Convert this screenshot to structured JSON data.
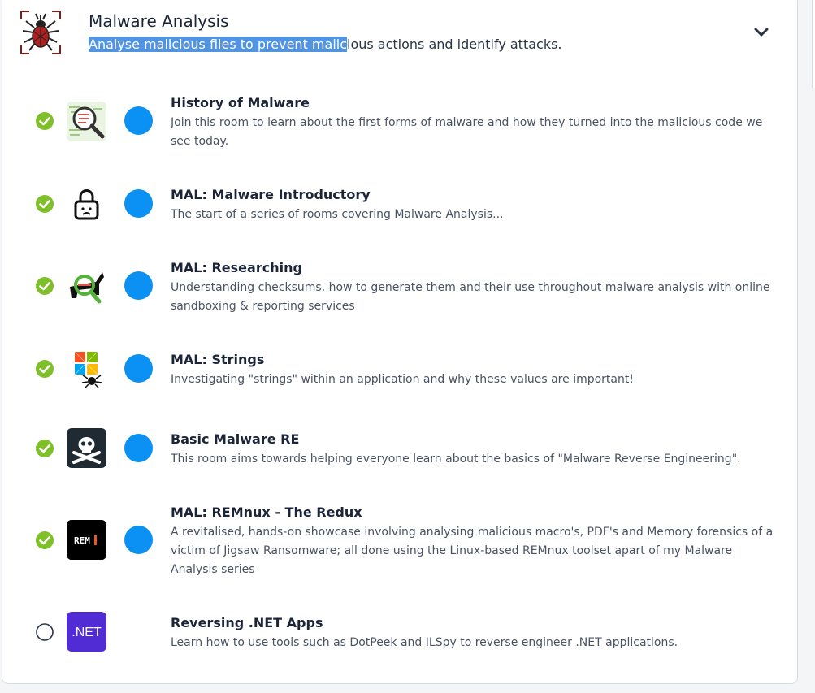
{
  "module": {
    "title": "Malware Analysis",
    "description_selected": "Analyse malicious files to prevent malic",
    "description_rest": "ious actions and identify attacks.",
    "logo_icon": "spider-bug-icon",
    "expand_icon": "chevron-down-icon"
  },
  "colors": {
    "complete_green": "#7fbf2a",
    "room_dot_blue": "#0b91f3",
    "selection_blue": "#5294e2",
    "dotnet_purple": "#512bd4"
  },
  "rooms": [
    {
      "title": "History of Malware",
      "description": "Join this room to learn about the first forms of malware and how they turned into the malicious code we see today.",
      "completed": true,
      "icon": "magnifier-code-icon"
    },
    {
      "title": "MAL: Malware Introductory",
      "description": "The start of a series of rooms covering Malware Analysis...",
      "completed": true,
      "icon": "padlock-icon"
    },
    {
      "title": "MAL: Researching",
      "description": "Understanding checksums, how to generate them and their use throughout malware analysis with online sandboxing & reporting services",
      "completed": true,
      "icon": "research-horse-icon"
    },
    {
      "title": "MAL: Strings",
      "description": "Investigating \"strings\" within an application and why these values are important!",
      "completed": true,
      "icon": "windows-spider-icon"
    },
    {
      "title": "Basic Malware RE",
      "description": "This room aims towards helping everyone learn about the basics of \"Malware Reverse Engineering\".",
      "completed": true,
      "icon": "skull-crossbones-icon"
    },
    {
      "title": "MAL: REMnux - The Redux",
      "description": "A revitalised, hands-on showcase involving analysing malicious macro's, PDF's and Memory forensics of a victim of Jigsaw Ransomware; all done using the Linux-based REMnux toolset apart of my Malware Analysis series",
      "completed": true,
      "icon": "remnux-icon",
      "icon_text": "REM"
    },
    {
      "title": "Reversing .NET Apps",
      "description": "Learn how to use tools such as DotPeek and ILSpy to reverse engineer .NET applications.",
      "completed": false,
      "icon": "dotnet-icon",
      "icon_text": ".NET"
    }
  ]
}
